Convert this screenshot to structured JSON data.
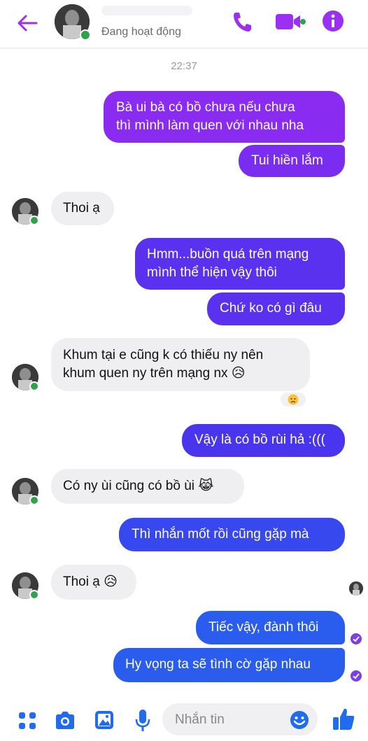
{
  "header": {
    "status": "Đang hoạt động",
    "icons": [
      "back-arrow-icon",
      "phone-icon",
      "video-call-icon",
      "info-icon"
    ],
    "accent_color": "#9b30f0",
    "online_color": "#31a24c"
  },
  "timestamp": "22:37",
  "messages": [
    {
      "sender": "me",
      "lines": [
        "Bà ui bà có bồ chưa nếu chưa",
        "thì mình làm quen với nhau nha"
      ]
    },
    {
      "sender": "me",
      "lines": [
        "Tui hiền lắm"
      ]
    },
    {
      "sender": "them",
      "lines": [
        "Thoi ạ"
      ]
    },
    {
      "sender": "me",
      "lines": [
        "Hmm...buồn quá trên mạng",
        "mình thể hiện vậy thôi"
      ]
    },
    {
      "sender": "me",
      "lines": [
        "Chứ ko có gì đâu"
      ]
    },
    {
      "sender": "them",
      "lines": [
        "Khum tại e cũng k có thiếu ny nên",
        "khum quen ny trên mạng nx 😥"
      ],
      "reaction": "😥"
    },
    {
      "sender": "me",
      "lines": [
        "Vậy là có bồ rùi hả :((("
      ]
    },
    {
      "sender": "them",
      "lines": [
        "Có ny ùi cũng có bồ ùi 😹"
      ]
    },
    {
      "sender": "me",
      "lines": [
        "Thì nhắn mốt rồi cũng gặp mà"
      ]
    },
    {
      "sender": "them",
      "lines": [
        "Thoi ạ 😥"
      ]
    },
    {
      "sender": "me",
      "lines": [
        "Tiếc vậy, đành thôi"
      ]
    },
    {
      "sender": "me",
      "lines": [
        "Hy vọng ta sẽ tình cờ gặp nhau"
      ]
    }
  ],
  "composer": {
    "placeholder": "Nhắn tin",
    "icons": [
      "menu-dots-icon",
      "camera-icon",
      "gallery-icon",
      "microphone-icon",
      "emoji-icon",
      "like-icon"
    ]
  }
}
